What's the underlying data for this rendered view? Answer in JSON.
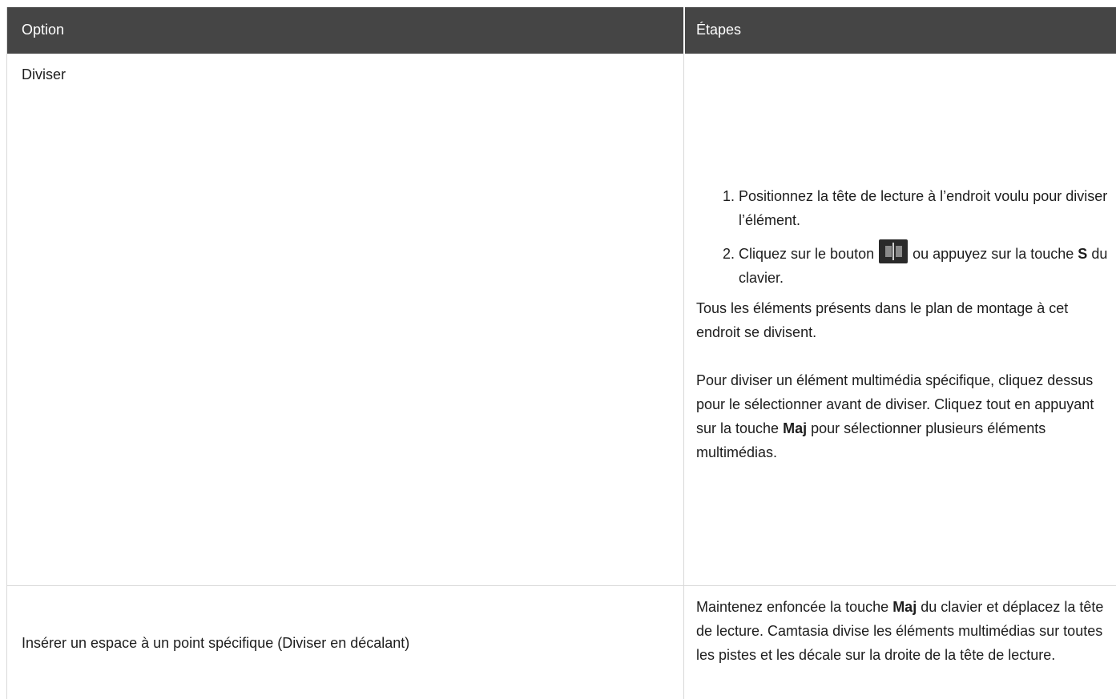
{
  "header": {
    "option": "Option",
    "steps": "Étapes"
  },
  "rows": [
    {
      "option": "Diviser",
      "steps_list": [
        {
          "text": "Positionnez la tête de lecture à l’endroit voulu pour diviser l’élément."
        },
        {
          "before": "Cliquez sur le bouton",
          "icon": "split-icon",
          "after": "ou appuyez sur la touche",
          "key": "S",
          "end": "du clavier."
        }
      ],
      "note1": "Tous les éléments présents dans le plan de montage à cet endroit se divisent.",
      "note2_before": "Pour diviser un élément multimédia spécifique, cliquez dessus pour le sélectionner avant de diviser. Cliquez tout en appuyant sur la touche",
      "note2_key": "Maj",
      "note2_after": "pour sélectionner plusieurs éléments multimédias."
    },
    {
      "option": "Insérer un espace à un point spécifique (Diviser en décalant)",
      "steps_before": "Maintenez enfoncée la touche",
      "steps_key": "Maj",
      "steps_after": "du clavier et déplacez la tête de lecture. Camtasia divise les éléments multimédias sur toutes les pistes et les décale sur la droite de la tête de lecture."
    }
  ]
}
